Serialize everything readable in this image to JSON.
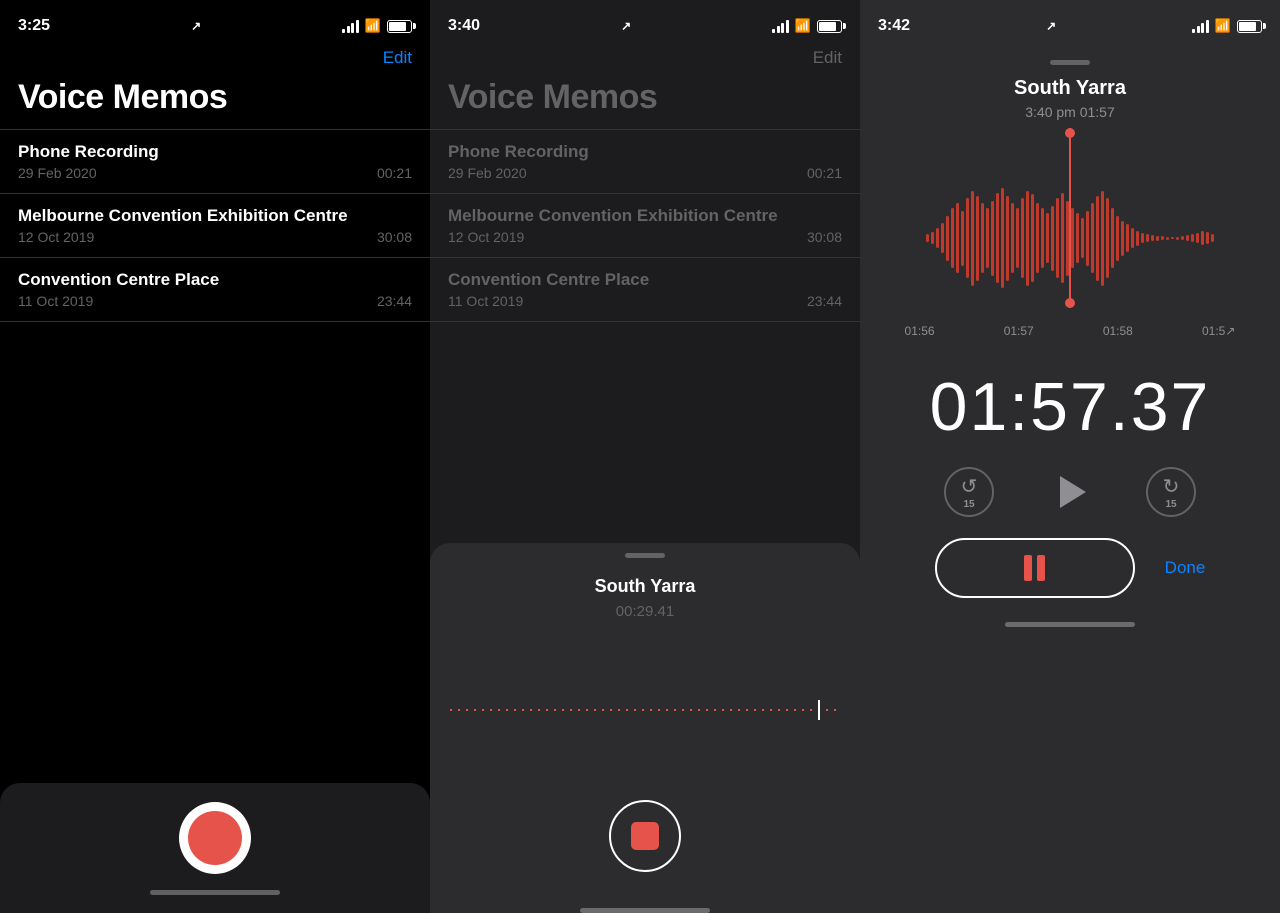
{
  "panel1": {
    "status": {
      "time": "3:25",
      "arrow": "↗"
    },
    "edit_label": "Edit",
    "title": "Voice Memos",
    "recordings": [
      {
        "name": "Phone Recording",
        "date": "29 Feb 2020",
        "duration": "00:21"
      },
      {
        "name": "Melbourne Convention Exhibition Centre",
        "date": "12 Oct 2019",
        "duration": "30:08"
      },
      {
        "name": "Convention Centre Place",
        "date": "11 Oct 2019",
        "duration": "23:44"
      }
    ]
  },
  "panel2": {
    "status": {
      "time": "3:40",
      "arrow": "↗"
    },
    "edit_label": "Edit",
    "title": "Voice Memos",
    "recordings": [
      {
        "name": "Phone Recording",
        "date": "29 Feb 2020",
        "duration": "00:21"
      },
      {
        "name": "Melbourne Convention Exhibition Centre",
        "date": "12 Oct 2019",
        "duration": "30:08"
      },
      {
        "name": "Convention Centre Place",
        "date": "11 Oct 2019",
        "duration": "23:44"
      }
    ],
    "modal": {
      "recording_name": "South Yarra",
      "recording_time": "00:29.41"
    }
  },
  "panel3": {
    "status": {
      "time": "3:42",
      "arrow": "↗"
    },
    "title": "South Yarra",
    "subtitle": "3:40 pm  01:57",
    "timeline": [
      "01:56",
      "01:57",
      "01:58",
      "01:5↗"
    ],
    "big_timer": "01:57.37",
    "done_label": "Done"
  }
}
